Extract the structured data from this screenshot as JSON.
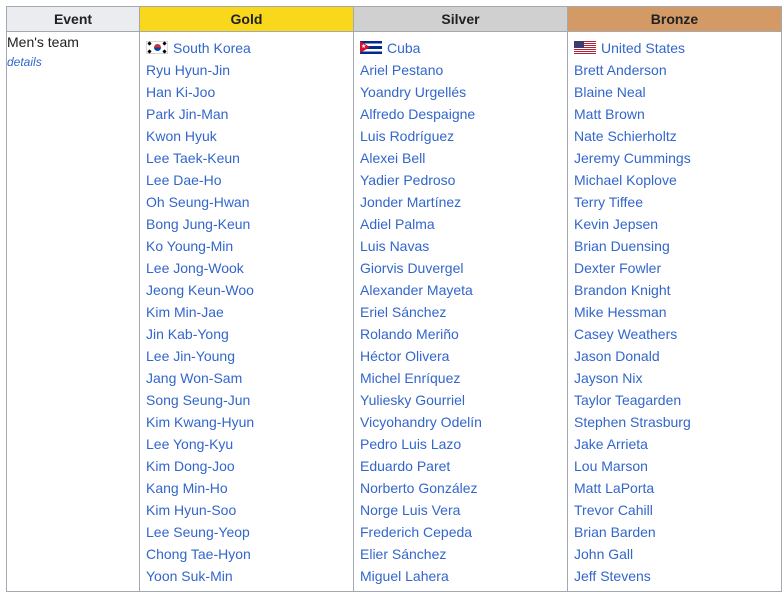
{
  "headers": {
    "event": "Event",
    "gold": "Gold",
    "silver": "Silver",
    "bronze": "Bronze"
  },
  "event": {
    "name": "Men's team",
    "details_link": "details"
  },
  "gold": {
    "nation": "South Korea",
    "flag_icon": "south-korea-flag-icon",
    "players": [
      "Ryu Hyun-Jin",
      "Han Ki-Joo",
      "Park Jin-Man",
      "Kwon Hyuk",
      "Lee Taek-Keun",
      "Lee Dae-Ho",
      "Oh Seung-Hwan",
      "Bong Jung-Keun",
      "Ko Young-Min",
      "Lee Jong-Wook",
      "Jeong Keun-Woo",
      "Kim Min-Jae",
      "Jin Kab-Yong",
      "Lee Jin-Young",
      "Jang Won-Sam",
      "Song Seung-Jun",
      "Kim Kwang-Hyun",
      "Lee Yong-Kyu",
      "Kim Dong-Joo",
      "Kang Min-Ho",
      "Kim Hyun-Soo",
      "Lee Seung-Yeop",
      "Chong Tae-Hyon",
      "Yoon Suk-Min"
    ]
  },
  "silver": {
    "nation": "Cuba",
    "flag_icon": "cuba-flag-icon",
    "players": [
      "Ariel Pestano",
      "Yoandry Urgellés",
      "Alfredo Despaigne",
      "Luis Rodríguez",
      "Alexei Bell",
      "Yadier Pedroso",
      "Jonder Martínez",
      "Adiel Palma",
      "Luis Navas",
      "Giorvis Duvergel",
      "Alexander Mayeta",
      "Eriel Sánchez",
      "Rolando Meriño",
      "Héctor Olivera",
      "Michel Enríquez",
      "Yuliesky Gourriel",
      "Vicyohandry Odelín",
      "Pedro Luis Lazo",
      "Eduardo Paret",
      "Norberto González",
      "Norge Luis Vera",
      "Frederich Cepeda",
      "Elier Sánchez",
      "Miguel Lahera"
    ]
  },
  "bronze": {
    "nation": "United States",
    "flag_icon": "united-states-flag-icon",
    "players": [
      "Brett Anderson",
      "Blaine Neal",
      "Matt Brown",
      "Nate Schierholtz",
      "Jeremy Cummings",
      "Michael Koplove",
      "Terry Tiffee",
      "Kevin Jepsen",
      "Brian Duensing",
      "Dexter Fowler",
      "Brandon Knight",
      "Mike Hessman",
      "Casey Weathers",
      "Jason Donald",
      "Jayson Nix",
      "Taylor Teagarden",
      "Stephen Strasburg",
      "Jake Arrieta",
      "Lou Marson",
      "Matt LaPorta",
      "Trevor Cahill",
      "Brian Barden",
      "John Gall",
      "Jeff Stevens"
    ]
  },
  "colors": {
    "gold": "#f9d81b",
    "silver": "#d0d0d0",
    "bronze": "#d49a66",
    "header_gray": "#eaecf0",
    "link": "#3366cc",
    "border": "#a2a9b1"
  }
}
